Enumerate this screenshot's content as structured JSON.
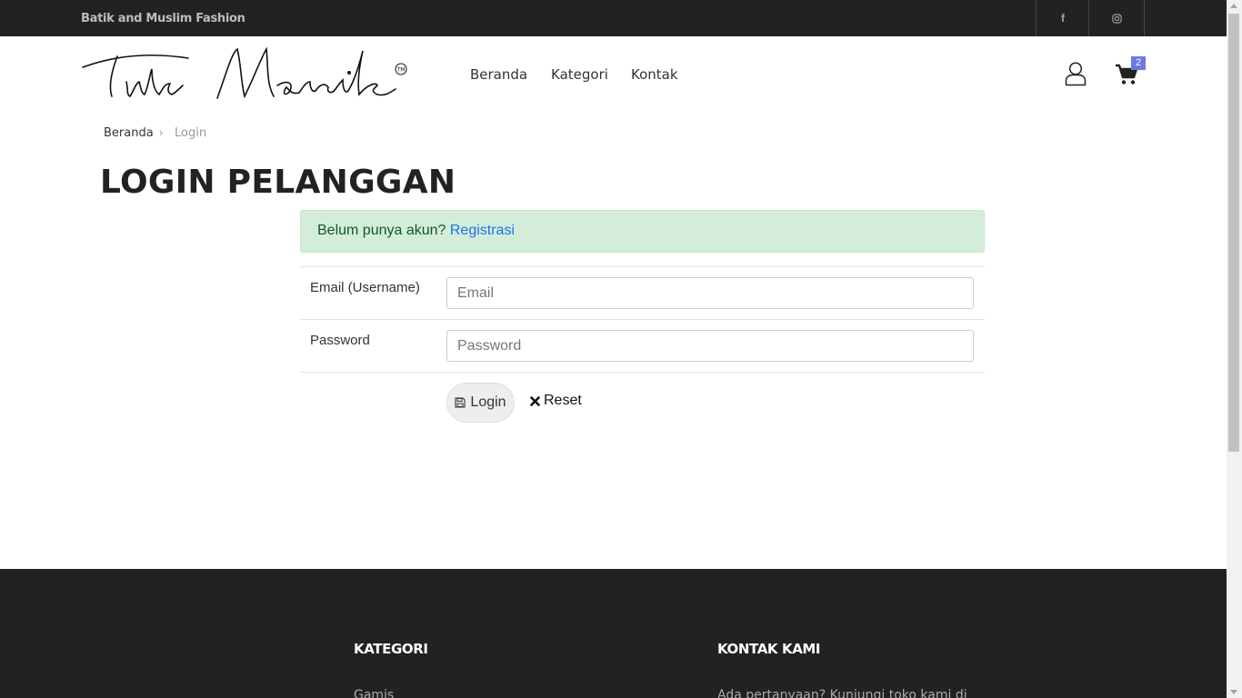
{
  "topbar": {
    "tagline": "Batik and Muslim Fashion",
    "social": [
      {
        "icon": "facebook-icon",
        "glyph": "f"
      },
      {
        "icon": "instagram-icon",
        "glyph": "◎"
      }
    ]
  },
  "header": {
    "logo_text": "Tirta Manik",
    "logo_mark": "TM",
    "nav": [
      "Beranda",
      "Kategori",
      "Kontak"
    ],
    "cart_count": "2"
  },
  "breadcrumb": {
    "home": "Beranda",
    "separator": "›",
    "current": "Login"
  },
  "page_title": "LOGIN PELANGGAN",
  "alert": {
    "text": "Belum punya akun? ",
    "link": "Registrasi",
    "color": "#d4edda"
  },
  "form": {
    "email_label": "Email (Username)",
    "email_placeholder": "Email",
    "email_value": "",
    "password_label": "Password",
    "password_placeholder": "Password",
    "password_value": "",
    "login_label": "Login",
    "reset_label": "Reset"
  },
  "footer": {
    "category_heading": "KATEGORI",
    "category_first": "Gamis",
    "contact_heading": "KONTAK KAMI",
    "contact_text": "Ada pertanyaan? Kunjungi toko kami di"
  },
  "colors": {
    "dark": "#222222",
    "link": "#1a73e8",
    "badge": "#6c7ae0"
  }
}
